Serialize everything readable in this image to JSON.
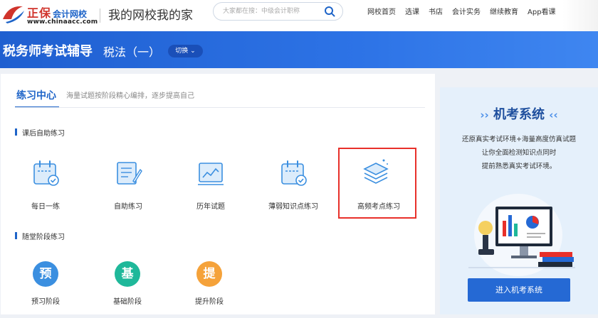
{
  "header": {
    "logo": {
      "name": "正保",
      "name_suffix": "会计网校",
      "url": "www.chinaacc.com"
    },
    "slogan": "我的网校我的家",
    "search": {
      "placeholder": "大家都在搜：中级会计职称",
      "icon": "search-icon"
    },
    "nav": [
      "网校首页",
      "选课",
      "书店",
      "会计实务",
      "继续教育",
      "App看课"
    ]
  },
  "banner": {
    "title": "税务师考试辅导",
    "subject": "税法（一）",
    "switch_label": "切换"
  },
  "practice": {
    "tab_title": "练习中心",
    "tab_desc": "海量试题按阶段精心编排，逐步提高自己",
    "section1_title": "课后自助练习",
    "cards": [
      {
        "label": "每日一练",
        "icon": "calendar-check-icon"
      },
      {
        "label": "自助练习",
        "icon": "notebook-pen-icon"
      },
      {
        "label": "历年试题",
        "icon": "chart-board-icon"
      },
      {
        "label": "薄弱知识点练习",
        "icon": "calendar-check-icon"
      },
      {
        "label": "高频考点练习",
        "icon": "layers-icon"
      }
    ],
    "section2_title": "随堂阶段练习",
    "stages": [
      {
        "char": "预",
        "label": "预习阶段",
        "color": "#3b8fe0"
      },
      {
        "char": "基",
        "label": "基础阶段",
        "color": "#1fb89a"
      },
      {
        "char": "提",
        "label": "提升阶段",
        "color": "#f5a23a"
      }
    ]
  },
  "exam_system": {
    "title": "机考系统",
    "desc_lines": [
      "还原真实考试环境+海量高度仿真试题",
      "让你全面检测知识点同时",
      "提前熟悉真实考试环境。"
    ],
    "button": "进入机考系统"
  },
  "colors": {
    "primary": "#1e64c8",
    "banner": "#2d73e6",
    "highlight": "#e8302a"
  }
}
